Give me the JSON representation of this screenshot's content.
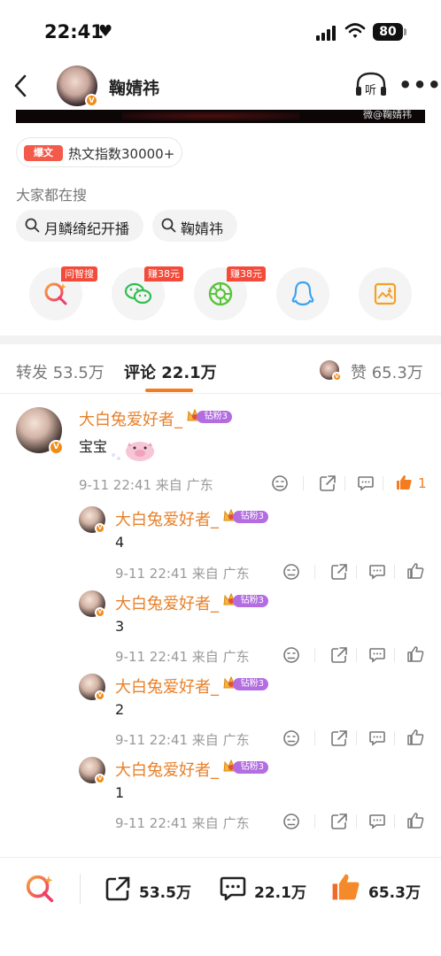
{
  "status": {
    "time": "22:41",
    "battery": "80"
  },
  "header": {
    "user_name": "鞠婧祎",
    "listen_label": "听"
  },
  "image": {
    "watermark": "微@鞠婧祎"
  },
  "hot": {
    "badge": "爆文",
    "text": "热文指数30000+"
  },
  "search": {
    "label": "大家都在搜",
    "chips": [
      "月鳞绮纪开播",
      "鞠婧祎"
    ]
  },
  "share": {
    "tags": [
      "问智搜",
      "赚38元",
      "赚38元"
    ]
  },
  "tabs": {
    "repost": "转发 53.5万",
    "comment": "评论 22.1万",
    "like": "赞 65.3万"
  },
  "comments": {
    "main": {
      "name": "大白兔爱好者_",
      "badge": "钻粉3",
      "text": "宝宝",
      "meta": "9-11 22:41 来自 广东",
      "likes": "1"
    },
    "replies": [
      {
        "name": "大白兔爱好者_",
        "badge": "钻粉3",
        "text": "4",
        "meta": "9-11 22:41 来自 广东"
      },
      {
        "name": "大白兔爱好者_",
        "badge": "钻粉3",
        "text": "3",
        "meta": "9-11 22:41 来自 广东"
      },
      {
        "name": "大白兔爱好者_",
        "badge": "钻粉3",
        "text": "2",
        "meta": "9-11 22:41 来自 广东"
      },
      {
        "name": "大白兔爱好者_",
        "badge": "钻粉3",
        "text": "1",
        "meta": "9-11 22:41 来自 广东"
      }
    ]
  },
  "bottom_bar": {
    "repost": "53.5万",
    "comment": "22.1万",
    "like": "65.3万"
  },
  "colors": {
    "accent": "#f47c20",
    "name": "#e8802a",
    "badge_red": "#f44a3a",
    "fan": "#b36de0"
  }
}
